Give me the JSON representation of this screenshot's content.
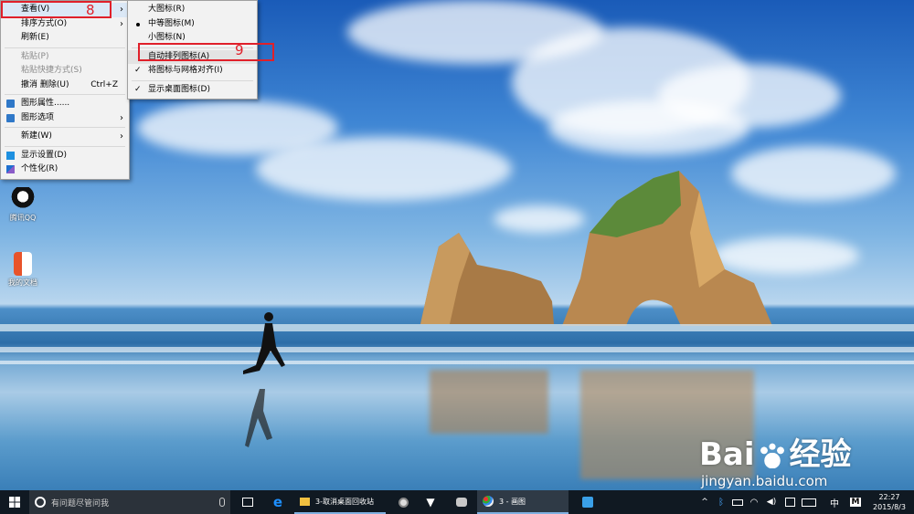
{
  "colors": {
    "highlight_red": "#e0202a",
    "menu_bg": "#f2f2f2",
    "taskbar_bg": "#101922",
    "accent_blue": "#0078d7"
  },
  "desktop_icons": [
    {
      "label": "腾讯QQ",
      "icon": "qq-penguin-icon"
    },
    {
      "label": "我的文档",
      "icon": "office-document-icon"
    }
  ],
  "context_menu": {
    "items": [
      {
        "label": "查看(V)",
        "submenu": true,
        "highlighted": true
      },
      {
        "label": "排序方式(O)",
        "submenu": true
      },
      {
        "label": "刷新(E)"
      },
      {
        "label": "粘贴(P)",
        "disabled": true
      },
      {
        "label": "粘贴快捷方式(S)",
        "disabled": true
      },
      {
        "label": "撤消 删除(U)",
        "shortcut": "Ctrl+Z"
      },
      {
        "label": "图形属性......",
        "icon": "intel-graphics-icon"
      },
      {
        "label": "图形选项",
        "icon": "intel-graphics-icon",
        "submenu": true
      },
      {
        "label": "新建(W)",
        "submenu": true
      },
      {
        "label": "显示设置(D)",
        "icon": "display-settings-icon"
      },
      {
        "label": "个性化(R)",
        "icon": "personalize-icon"
      }
    ]
  },
  "view_submenu": {
    "items": [
      {
        "label": "大图标(R)"
      },
      {
        "label": "中等图标(M)",
        "mark": "dot"
      },
      {
        "label": "小图标(N)"
      },
      {
        "label": "自动排列图标(A)",
        "highlighted": true
      },
      {
        "label": "将图标与网格对齐(I)",
        "mark": "check"
      },
      {
        "label": "显示桌面图标(D)",
        "mark": "check"
      }
    ]
  },
  "callouts": {
    "first": "8",
    "second": "9"
  },
  "taskbar": {
    "search_placeholder": "有问题尽管问我",
    "apps": [
      {
        "label": "3-取消桌面回收站",
        "icon": "folder-icon"
      },
      {
        "label": "3 - 画图",
        "icon": "paint-icon"
      }
    ],
    "tray": {
      "ime": "中",
      "ime_mode": "M",
      "time": "22:27",
      "date": "2015/8/3"
    }
  },
  "watermark": {
    "brand": "Bai",
    "brand_cn": "经验",
    "url": "jingyan.baidu.com"
  }
}
